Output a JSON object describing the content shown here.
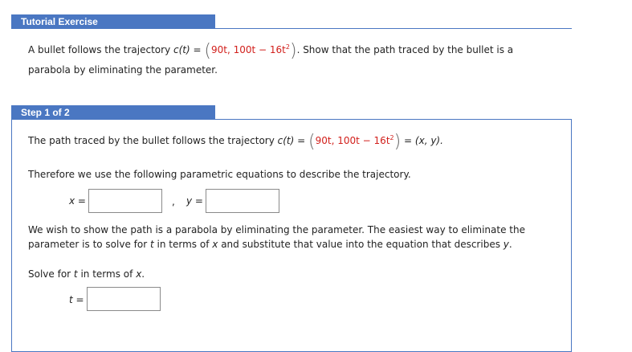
{
  "tutorial": {
    "header": "Tutorial Exercise",
    "intro_prefix": "A bullet follows the trajectory",
    "c_t": "c(t) =",
    "comp1": "90t,",
    "comp2_a": "100t − 16t",
    "exp2": "2",
    "intro_suffix": ". Show that the path traced by the bullet is a",
    "line2": "parabola by eliminating the parameter."
  },
  "step": {
    "header": "Step 1 of 2",
    "path_prefix": "The path traced by the bullet follows the trajectory",
    "c_t": "c(t) =",
    "comp1": "90t,",
    "comp2_a": "100t − 16t",
    "exp2": "2",
    "equals_xy": "= (x, y).",
    "therefore": "Therefore we use the following parametric equations to describe the trajectory.",
    "x_label": "x =",
    "comma": ",",
    "y_label": "y =",
    "wish_line1": "We wish to show the path is a parabola by eliminating the parameter. The easiest way to eliminate the",
    "wish_line2_a": "parameter is to solve for",
    "wish_line2_t": "t",
    "wish_line2_b": "in terms of",
    "wish_line2_x": "x",
    "wish_line2_c": "and substitute that value into the equation that describes",
    "wish_line2_y": "y",
    "wish_line2_end": ".",
    "solve_a": "Solve for",
    "solve_t": "t",
    "solve_b": "in terms of",
    "solve_x": "x",
    "solve_end": ".",
    "t_label": "t ="
  },
  "inputs": {
    "x_value": "",
    "y_value": "",
    "t_value": ""
  },
  "colors": {
    "header_bg": "#4a77c2",
    "red": "#d2201c"
  }
}
